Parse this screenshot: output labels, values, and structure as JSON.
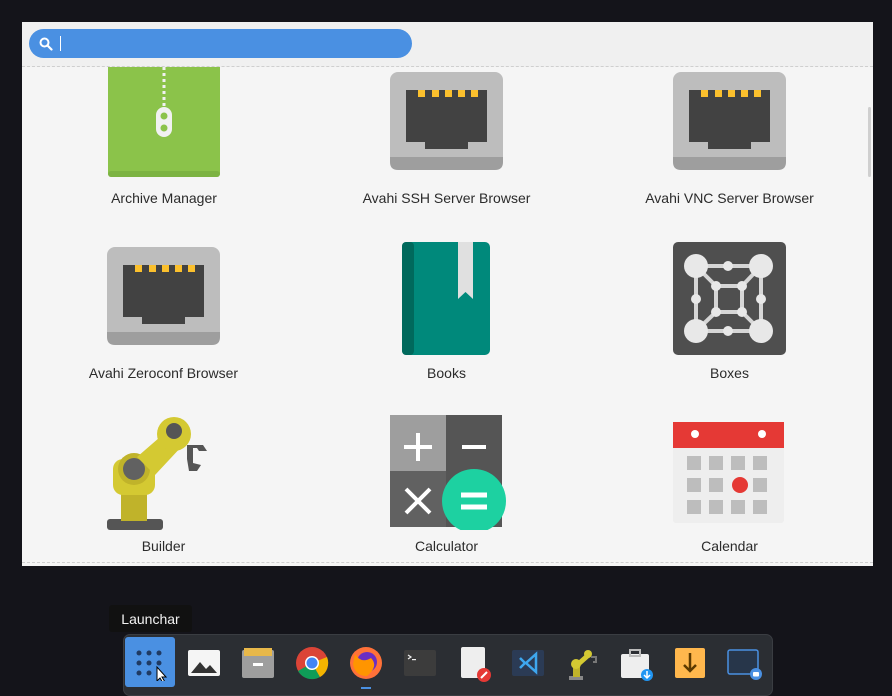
{
  "search": {
    "placeholder": "",
    "value": ""
  },
  "apps": [
    {
      "id": "archive-manager",
      "label": "Archive Manager"
    },
    {
      "id": "avahi-ssh",
      "label": "Avahi SSH Server Browser"
    },
    {
      "id": "avahi-vnc",
      "label": "Avahi VNC Server Browser"
    },
    {
      "id": "avahi-zeroconf",
      "label": "Avahi Zeroconf Browser"
    },
    {
      "id": "books",
      "label": "Books"
    },
    {
      "id": "boxes",
      "label": "Boxes"
    },
    {
      "id": "builder",
      "label": "Builder"
    },
    {
      "id": "calculator",
      "label": "Calculator"
    },
    {
      "id": "calendar",
      "label": "Calendar"
    }
  ],
  "tooltip": {
    "text": "Launchar"
  },
  "dock": [
    {
      "icon": "app-grid-icon",
      "active": true
    },
    {
      "icon": "image-viewer-icon"
    },
    {
      "icon": "archive-icon"
    },
    {
      "icon": "chrome-icon"
    },
    {
      "icon": "firefox-icon",
      "running": true
    },
    {
      "icon": "terminal-icon"
    },
    {
      "icon": "text-editor-icon"
    },
    {
      "icon": "vscode-icon"
    },
    {
      "icon": "builder-icon"
    },
    {
      "icon": "software-installer-icon"
    },
    {
      "icon": "download-icon"
    },
    {
      "icon": "screenshot-icon"
    }
  ],
  "colors": {
    "accent": "#4a90e2",
    "background": "#14141a",
    "panel": "#f5f5f5"
  }
}
